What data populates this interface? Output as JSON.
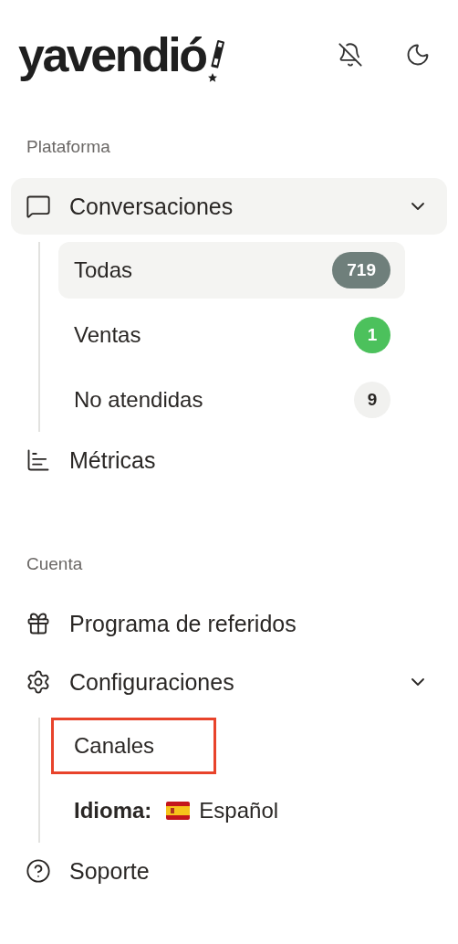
{
  "logo": {
    "text": "yavendió"
  },
  "sections": [
    {
      "title": "Plataforma",
      "items": [
        {
          "label": "Conversaciones",
          "selected": true,
          "expanded": true,
          "children": [
            {
              "kind": "counter",
              "label": "Todas",
              "selected": true,
              "badge": "719",
              "color": "#6f7f7b"
            },
            {
              "kind": "counter",
              "label": "Ventas",
              "selected": false,
              "badge": "1",
              "color": "#4cc15c"
            },
            {
              "kind": "counter",
              "label": "No atendidas",
              "selected": false,
              "badge": "9",
              "color": "#f1f1ef"
            }
          ]
        },
        {
          "label": "Métricas",
          "selected": false
        }
      ]
    },
    {
      "title": "Cuenta",
      "items": [
        {
          "label": "Programa de referidos",
          "selected": false
        },
        {
          "label": "Configuraciones",
          "selected": false,
          "expanded": true,
          "children": [
            {
              "kind": "link",
              "label": "Canales",
              "selected": false,
              "highlighted": true
            },
            {
              "kind": "language",
              "label": "Idioma:",
              "value": "Español",
              "selected": false
            }
          ]
        },
        {
          "label": "Soporte",
          "selected": false
        }
      ]
    }
  ]
}
